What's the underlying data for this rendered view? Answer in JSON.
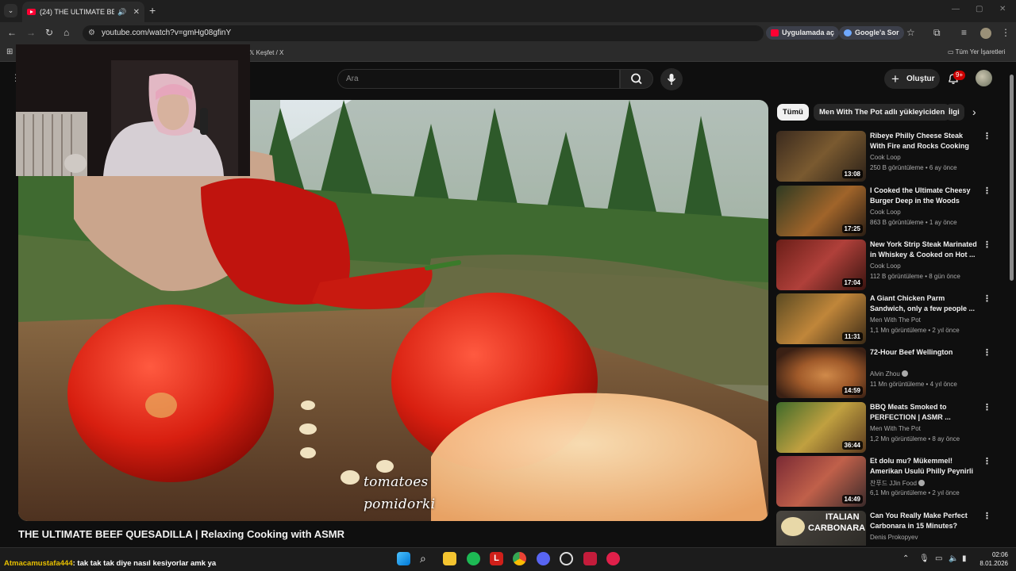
{
  "browser": {
    "tab_title": "(24) THE ULTIMATE BEEF Q",
    "url": "youtube.com/watch?v=gmHg08gfinY",
    "open_in_app": "Uygulamada aç",
    "ask_google": "Google'a Sor",
    "bookmark_explore": "Keşfet / X",
    "all_bookmarks": "Tüm Yer İşaretleri"
  },
  "youtube": {
    "search_placeholder": "Ara",
    "create_label": "Oluştur",
    "notification_badge": "9+"
  },
  "video": {
    "title": "THE ULTIMATE BEEF QUESADILLA | Relaxing Cooking with ASMR",
    "caption_line1": "tomatoes",
    "caption_line2": "pomidorki"
  },
  "chips": [
    "Tümü",
    "Men With The Pot adlı yükleyiciden",
    "İlgi"
  ],
  "recommendations": [
    {
      "title": "Ribeye Philly Cheese Steak With Fire and Rocks Cooking",
      "channel": "Cook Loop",
      "meta": "250 B görüntüleme • 6 ay önce",
      "duration": "13:08",
      "color": "#4a3a2a"
    },
    {
      "title": "I Cooked the Ultimate Cheesy Burger Deep in the Woods",
      "channel": "Cook Loop",
      "meta": "863 B görüntüleme • 1 ay önce",
      "duration": "17:25",
      "color": "#6b4a24"
    },
    {
      "title": "New York Strip Steak Marinated in Whiskey & Cooked on Hot ...",
      "channel": "Cook Loop",
      "meta": "112 B görüntüleme • 8 gün önce",
      "duration": "17:04",
      "color": "#8a2e2a"
    },
    {
      "title": "A Giant Chicken Parm Sandwich, only a few people ...",
      "channel": "Men With The Pot",
      "meta": "1,1 Mn görüntüleme • 2 yıl önce",
      "duration": "11:31",
      "color": "#7a5a2a"
    },
    {
      "title": "72-Hour Beef Wellington",
      "channel": "Alvin Zhou",
      "meta": "11 Mn görüntüleme • 4 yıl önce",
      "duration": "14:59",
      "color": "#9c5a30"
    },
    {
      "title": "BBQ Meats Smoked to PERFECTION | ASMR ...",
      "channel": "Men With The Pot",
      "meta": "1,2 Mn görüntüleme • 8 ay önce",
      "duration": "36:44",
      "color": "#3f5a2a"
    },
    {
      "title": "Et dolu mu? Mükemmel! Amerikan Usulü Philly Peynirli ...",
      "channel": "찬푸드 JJin Food",
      "meta": "6,1 Mn görüntüleme • 2 yıl önce",
      "duration": "14:49",
      "color": "#8a3a44"
    },
    {
      "title": "Can You Really Make Perfect Carbonara in 15 Minutes?",
      "channel": "Denis Prokopyev",
      "meta": "",
      "duration": "",
      "color": "#3a3a3a",
      "thumb_text1": "ITALIAN",
      "thumb_text2": "CARBONARA"
    }
  ],
  "chat": {
    "user": "Atmacamustafa444",
    "message": ": tak tak tak diye nasıl kesiyorlar amk ya"
  },
  "clock": {
    "time": "02:06",
    "date": "8.01.2026"
  }
}
